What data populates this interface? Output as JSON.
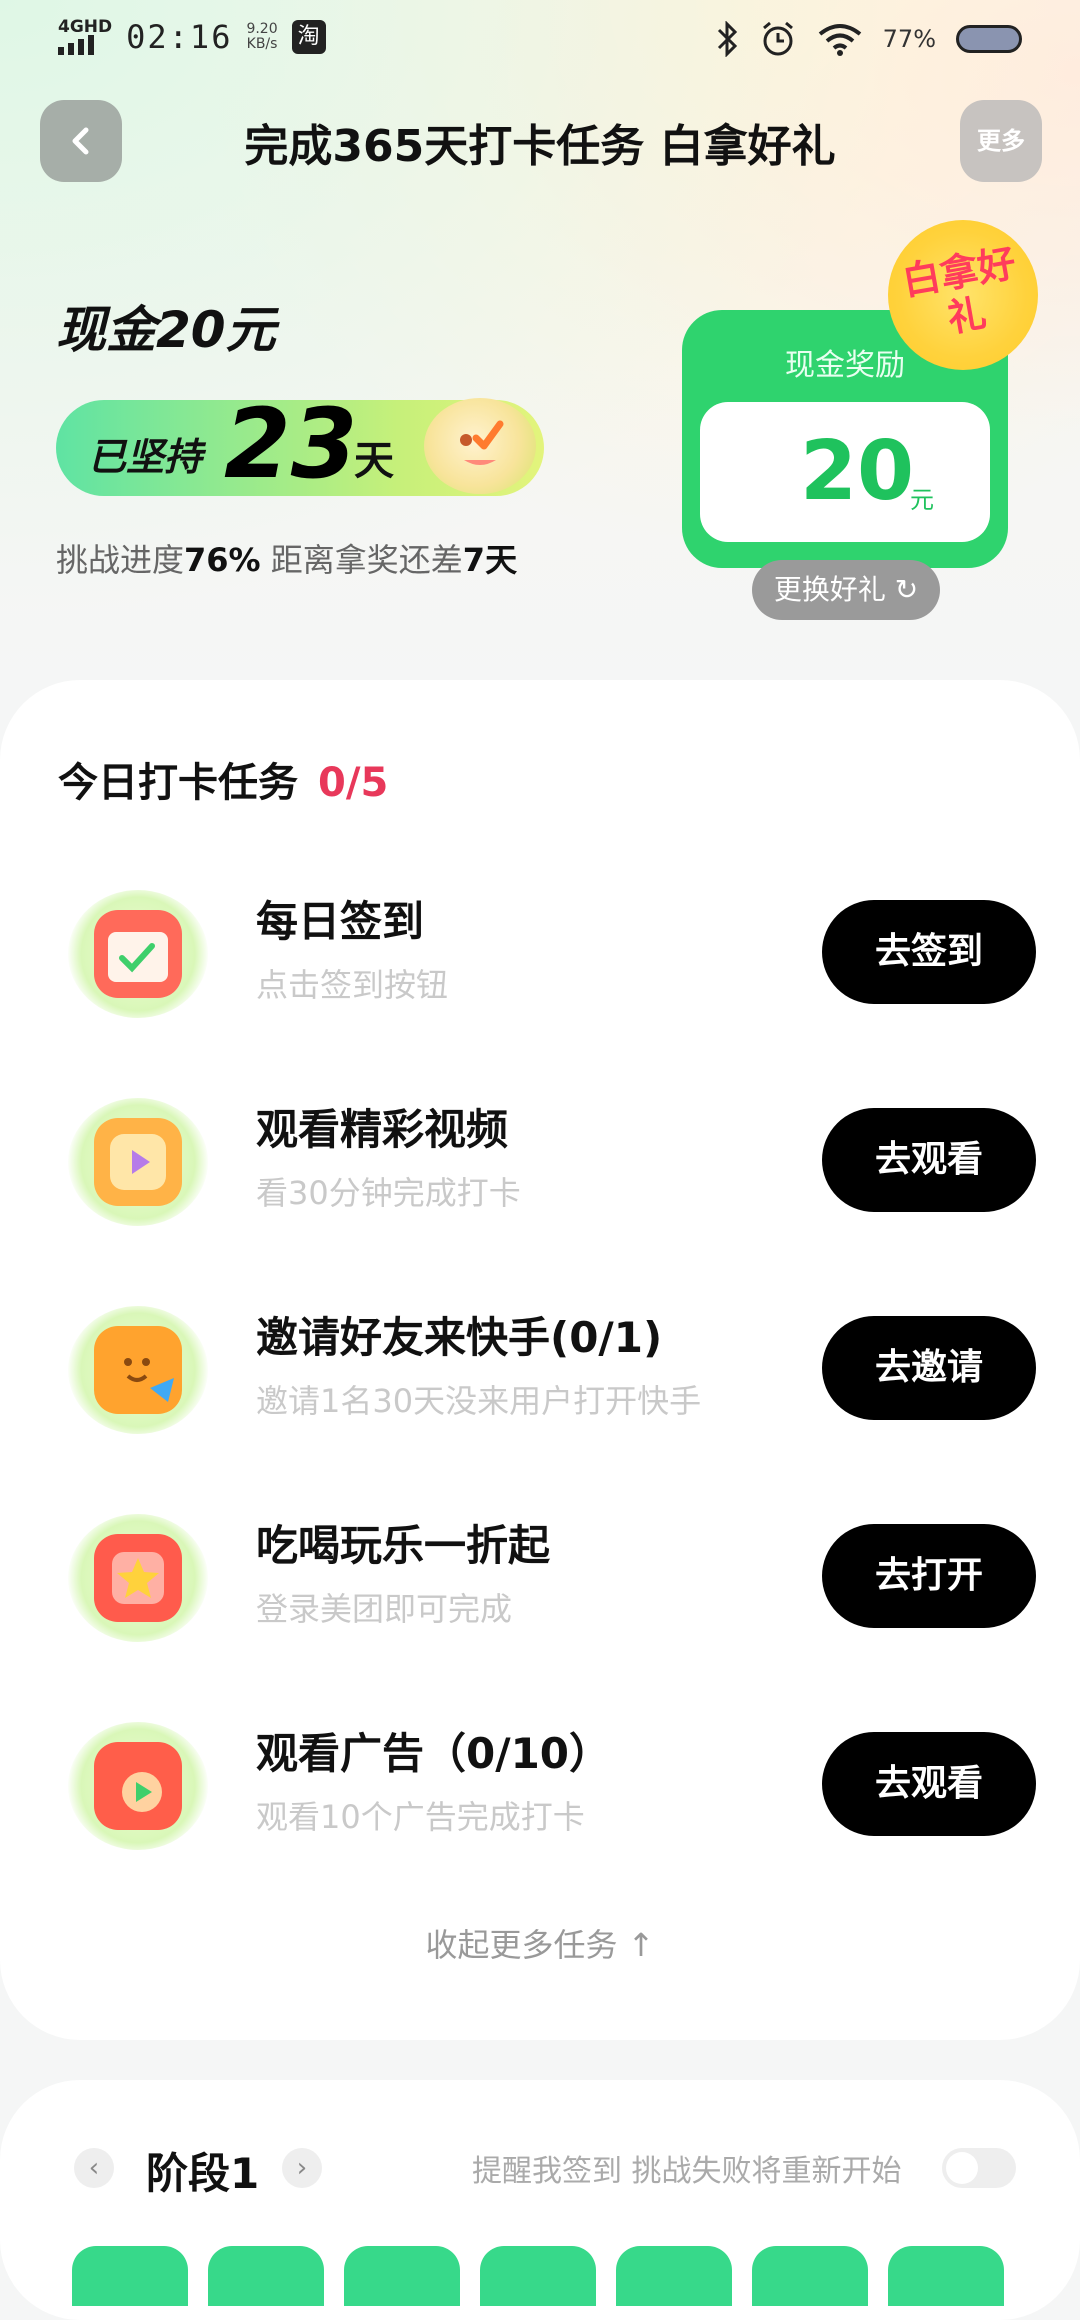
{
  "status_bar": {
    "network": "4GHD",
    "time": "02:16",
    "speed_value": "9.20",
    "speed_unit": "KB/s",
    "app_icon": "淘",
    "battery_text": "77%"
  },
  "header": {
    "title": "完成365天打卡任务 白拿好礼",
    "more_label": "更多"
  },
  "hero": {
    "cash_title": "现金20元",
    "streak_prefix": "已坚持",
    "streak_days": "23",
    "streak_unit": "天",
    "progress_label": "挑战进度",
    "progress_value": "76%",
    "remaining_label": " 距离拿奖还差",
    "remaining_days": "7天"
  },
  "reward": {
    "label": "现金奖励",
    "amount": "20",
    "unit": "元",
    "badge": "白拿好礼",
    "change_label": "更换好礼 ↻"
  },
  "tasks": {
    "title": "今日打卡任务",
    "count": "0/5",
    "items": [
      {
        "title": "每日签到",
        "subtitle": "点击签到按钮",
        "button": "去签到",
        "icon": "calendar-icon",
        "color": "#ff6a5a"
      },
      {
        "title": "观看精彩视频",
        "subtitle": "看30分钟完成打卡",
        "button": "去观看",
        "icon": "video-play-icon",
        "color": "#ffb347"
      },
      {
        "title": "邀请好友来快手(0/1)",
        "subtitle": "邀请1名30天没来用户打开快手",
        "button": "去邀请",
        "icon": "invite-friend-icon",
        "color": "#ffa32e"
      },
      {
        "title": "吃喝玩乐一折起",
        "subtitle": "登录美团即可完成",
        "button": "去打开",
        "icon": "star-coupon-icon",
        "color": "#ff5b4c"
      },
      {
        "title": "观看广告（0/10）",
        "subtitle": "观看10个广告完成打卡",
        "button": "去观看",
        "icon": "ad-play-icon",
        "color": "#ff5e4a"
      }
    ],
    "collapse_label": "收起更多任务 ↑"
  },
  "stage": {
    "label": "阶段1",
    "prev": "‹",
    "next": "›",
    "hint": "提醒我签到 挑战失败将重新开始"
  },
  "colors": {
    "accent_green": "#2fd36e",
    "count_red": "#e8385a",
    "button_black": "#000000"
  }
}
